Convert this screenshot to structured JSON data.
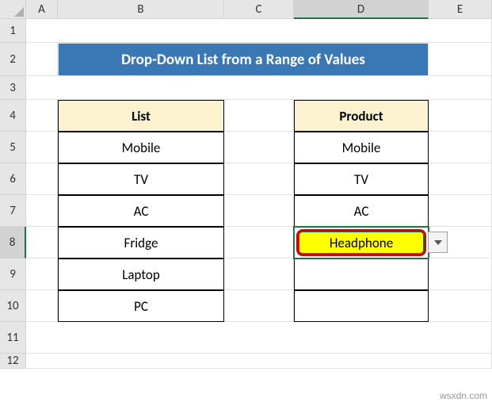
{
  "columns": [
    "A",
    "B",
    "C",
    "D",
    "E"
  ],
  "rows": [
    "1",
    "2",
    "3",
    "4",
    "5",
    "6",
    "7",
    "8",
    "9",
    "10",
    "11",
    "12"
  ],
  "banner": "Drop-Down List from a Range of Values",
  "list": {
    "header": "List",
    "items": [
      "Mobile",
      "TV",
      "AC",
      "Fridge",
      "Laptop",
      "PC"
    ]
  },
  "product": {
    "header": "Product",
    "items": [
      "Mobile",
      "TV",
      "AC",
      "Headphone",
      "",
      ""
    ]
  },
  "active_cell": {
    "col": "D",
    "row": 8,
    "value": "Headphone"
  },
  "watermark": "wsxdn.com",
  "chart_data": {
    "type": "table",
    "title": "Drop-Down List from a Range of Values",
    "series": [
      {
        "name": "List",
        "values": [
          "Mobile",
          "TV",
          "AC",
          "Fridge",
          "Laptop",
          "PC"
        ]
      },
      {
        "name": "Product",
        "values": [
          "Mobile",
          "TV",
          "AC",
          "Headphone",
          "",
          ""
        ]
      }
    ]
  }
}
